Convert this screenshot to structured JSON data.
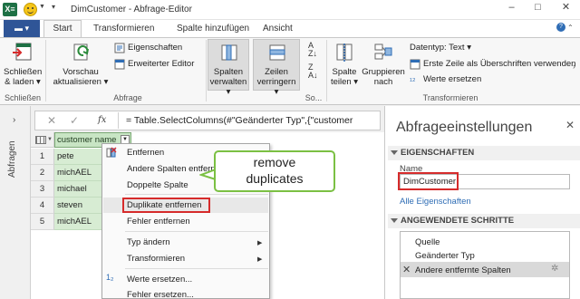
{
  "app": {
    "title": "DimCustomer - Abfrage-Editor",
    "icon": "X≡",
    "window_buttons": {
      "minimize": "–",
      "maximize": "□",
      "close": "✕"
    }
  },
  "tabs": {
    "file": "▬ ▾",
    "items": [
      "Start",
      "Transformieren",
      "Spalte hinzufügen",
      "Ansicht"
    ],
    "active": "Start"
  },
  "ribbon": {
    "close_load": {
      "label_line1": "Schließen",
      "label_line2": "& laden ▾",
      "group": "Schließen"
    },
    "refresh": {
      "label_line1": "Vorschau",
      "label_line2": "aktualisieren ▾"
    },
    "properties": "Eigenschaften",
    "advanced_editor": "Erweiterter Editor",
    "query_group": "Abfrage",
    "manage_columns": {
      "label_line1": "Spalten",
      "label_line2": "verwalten ▾"
    },
    "reduce_rows": {
      "label_line1": "Zeilen",
      "label_line2": "verringern ▾"
    },
    "sort_group": "So...",
    "split_column": {
      "label_line1": "Spalte",
      "label_line2": "teilen ▾"
    },
    "group_by": {
      "label_line1": "Gruppieren",
      "label_line2": "nach"
    },
    "data_type": "Datentyp: Text ▾",
    "first_row_headers": "Erste Zeile als Überschriften verwenden",
    "replace_values": "Werte ersetzen",
    "transform_group": "Transformieren"
  },
  "left_nav": {
    "label": "Abfragen",
    "chevron": "›"
  },
  "formula": {
    "cancel": "✕",
    "commit": "✓",
    "fx": "fx",
    "text": "= Table.SelectColumns(#\"Geänderter Typ\",{\"customer"
  },
  "grid": {
    "column": "customer name",
    "rows": [
      {
        "num": "1",
        "value": "pete"
      },
      {
        "num": "2",
        "value": "michAEL"
      },
      {
        "num": "3",
        "value": "michael"
      },
      {
        "num": "4",
        "value": "steven"
      },
      {
        "num": "5",
        "value": "michAEL"
      }
    ]
  },
  "context_menu": {
    "items": [
      "Entfernen",
      "Andere Spalten entfern",
      "Doppelte Spalte",
      "Duplikate entfernen",
      "Fehler entfernen",
      "Typ ändern",
      "Transformieren",
      "Werte ersetzen...",
      "Fehler ersetzen..."
    ]
  },
  "callout": {
    "line1": "remove",
    "line2": "duplicates"
  },
  "panel": {
    "title": "Abfrageeinstellungen",
    "close": "✕",
    "properties_header": "EIGENSCHAFTEN",
    "name_label": "Name",
    "name_value": "DimCustomer",
    "all_properties": "Alle Eigenschaften",
    "steps_header": "ANGEWENDETE SCHRITTE",
    "steps": [
      "Quelle",
      "Geänderter Typ",
      "Andere entfernte Spalten"
    ],
    "selected_step": "Andere entfernte Spalten"
  },
  "colors": {
    "excel_green": "#1e7145",
    "file_tab": "#2f5597",
    "column_header": "#c8e5c4",
    "cell_fill": "#d7ecd3",
    "highlight_red": "#d62b2b",
    "callout_border": "#7bc043",
    "link": "#2f6db5"
  }
}
